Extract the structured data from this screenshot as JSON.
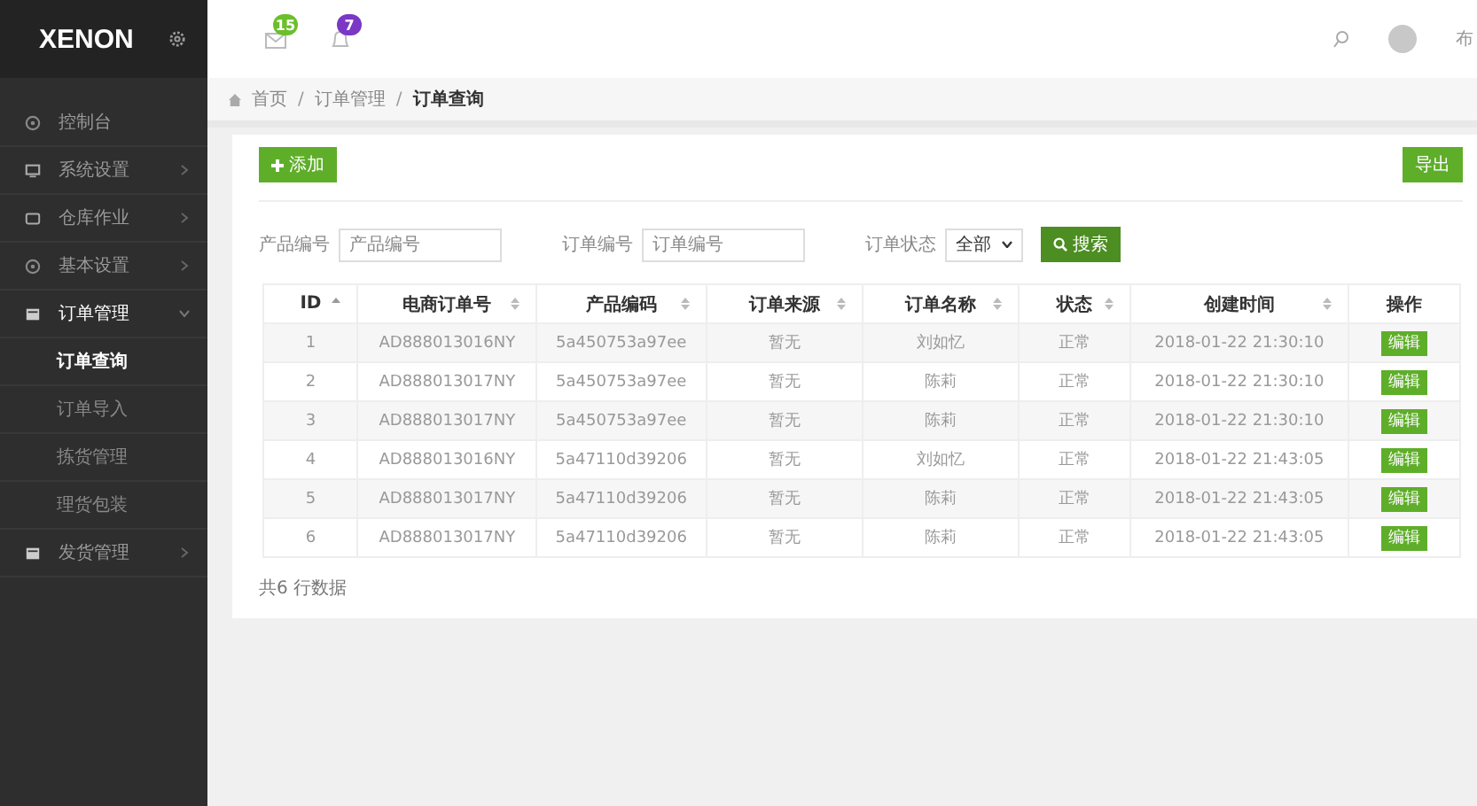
{
  "brand": "XENON",
  "header": {
    "mail_count": "15",
    "bell_count": "7",
    "user": "布"
  },
  "sidebar": {
    "items": [
      {
        "label": "控制台",
        "kind": "link",
        "expanded": false
      },
      {
        "label": "系统设置",
        "kind": "menu",
        "expanded": false
      },
      {
        "label": "仓库作业",
        "kind": "menu",
        "expanded": false
      },
      {
        "label": "基本设置",
        "kind": "menu",
        "expanded": false
      },
      {
        "label": "订单管理",
        "kind": "menu",
        "expanded": true,
        "children": [
          {
            "label": "订单查询",
            "selected": true
          },
          {
            "label": "订单导入",
            "selected": false
          },
          {
            "label": "拣货管理",
            "selected": false
          },
          {
            "label": "理货包装",
            "selected": false
          }
        ]
      },
      {
        "label": "发货管理",
        "kind": "menu",
        "expanded": false
      }
    ]
  },
  "breadcrumb": [
    {
      "kind": "link",
      "text": "首页"
    },
    {
      "kind": "separator",
      "text": "/"
    },
    {
      "kind": "link",
      "text": "订单管理"
    },
    {
      "kind": "separator",
      "text": "/"
    },
    {
      "kind": "current",
      "text": "订单查询"
    }
  ],
  "toolbar": {
    "add": "添加",
    "export": "导出"
  },
  "filters": [
    {
      "kind": "input",
      "label": "产品编号",
      "placeholder": "产品编号"
    },
    {
      "kind": "input",
      "label": "订单编号",
      "placeholder": "订单编号"
    },
    {
      "kind": "select",
      "label": "订单状态",
      "value": "全部"
    }
  ],
  "search_button": "搜索",
  "table": {
    "columns": [
      {
        "label": "ID",
        "kind": "sorted"
      },
      {
        "label": "电商订单号",
        "kind": "sortable"
      },
      {
        "label": "产品编码",
        "kind": "sortable"
      },
      {
        "label": "订单来源",
        "kind": "sortable"
      },
      {
        "label": "订单名称",
        "kind": "sortable"
      },
      {
        "label": "状态",
        "kind": "sortable"
      },
      {
        "label": "创建时间",
        "kind": "sortable"
      },
      {
        "label": "操作",
        "kind": "plain"
      }
    ],
    "rows": [
      {
        "cells": [
          "1",
          "AD888013016NY",
          "5a450753a97ee",
          "暂无",
          "刘如忆",
          "正常",
          "2018-01-22 21:30:10"
        ],
        "action": "编辑"
      },
      {
        "cells": [
          "2",
          "AD888013017NY",
          "5a450753a97ee",
          "暂无",
          "陈莉",
          "正常",
          "2018-01-22 21:30:10"
        ],
        "action": "编辑"
      },
      {
        "cells": [
          "3",
          "AD888013017NY",
          "5a450753a97ee",
          "暂无",
          "陈莉",
          "正常",
          "2018-01-22 21:30:10"
        ],
        "action": "编辑"
      },
      {
        "cells": [
          "4",
          "AD888013016NY",
          "5a47110d39206",
          "暂无",
          "刘如忆",
          "正常",
          "2018-01-22 21:43:05"
        ],
        "action": "编辑"
      },
      {
        "cells": [
          "5",
          "AD888013017NY",
          "5a47110d39206",
          "暂无",
          "陈莉",
          "正常",
          "2018-01-22 21:43:05"
        ],
        "action": "编辑"
      },
      {
        "cells": [
          "6",
          "AD888013017NY",
          "5a47110d39206",
          "暂无",
          "陈莉",
          "正常",
          "2018-01-22 21:43:05"
        ],
        "action": "编辑"
      }
    ]
  },
  "footer": "共6 行数据"
}
